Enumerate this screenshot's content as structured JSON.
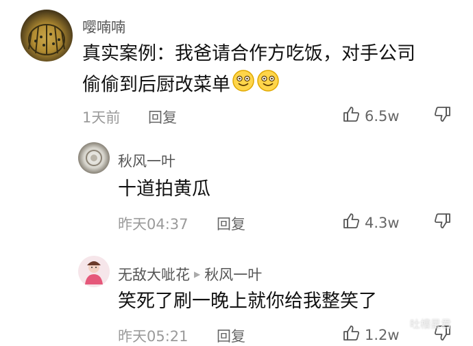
{
  "comments": [
    {
      "username": "嘤喃喃",
      "text_line1": "真实案例：我爸请合作方吃饭，对手公司",
      "text_line2": "偷偷到后厨改菜单",
      "time": "1天前",
      "reply_label": "回复",
      "likes": "6.5w"
    },
    {
      "username": "秋风一叶",
      "text": "十道拍黄瓜",
      "time": "昨天04:37",
      "reply_label": "回复",
      "likes": "4.3w"
    },
    {
      "username": "无敌大呲花",
      "reply_to": "秋风一叶",
      "text": "笑死了刷一晚上就你给我整笑了",
      "time": "昨天05:21",
      "reply_label": "回复",
      "likes": "1.2w"
    }
  ],
  "watermark": "吐槽星君",
  "icons": {
    "like": "thumbs-up-icon",
    "dislike": "thumbs-down-icon",
    "reply_arrow": "triangle-right-icon",
    "wechat": "wechat-icon"
  }
}
